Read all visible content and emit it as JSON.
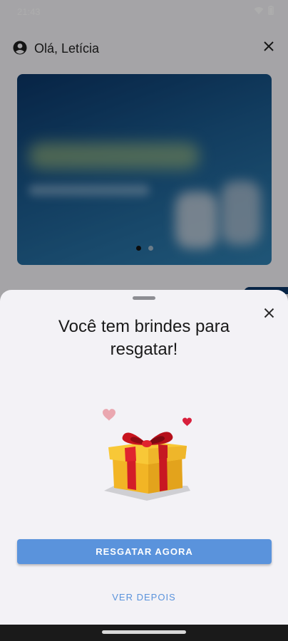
{
  "status_bar": {
    "time": "21:43",
    "icons": [
      "wifi-icon",
      "battery-icon"
    ]
  },
  "header": {
    "greeting": "Olá, Letícia",
    "icons": [
      "account-circle-icon",
      "close-icon"
    ]
  },
  "banner": {
    "pager": {
      "count": 2,
      "active_index": 0
    }
  },
  "sheet": {
    "title": "Você tem brindes para resgatar!",
    "illustration": "gift-box-with-hearts",
    "primary_button": "RESGATAR AGORA",
    "secondary_button": "VER DEPOIS"
  },
  "colors": {
    "accent": "#5a93dc",
    "gift_body": "#f6c235",
    "gift_ribbon": "#d11f2a",
    "heart": "#e8a5ad"
  }
}
